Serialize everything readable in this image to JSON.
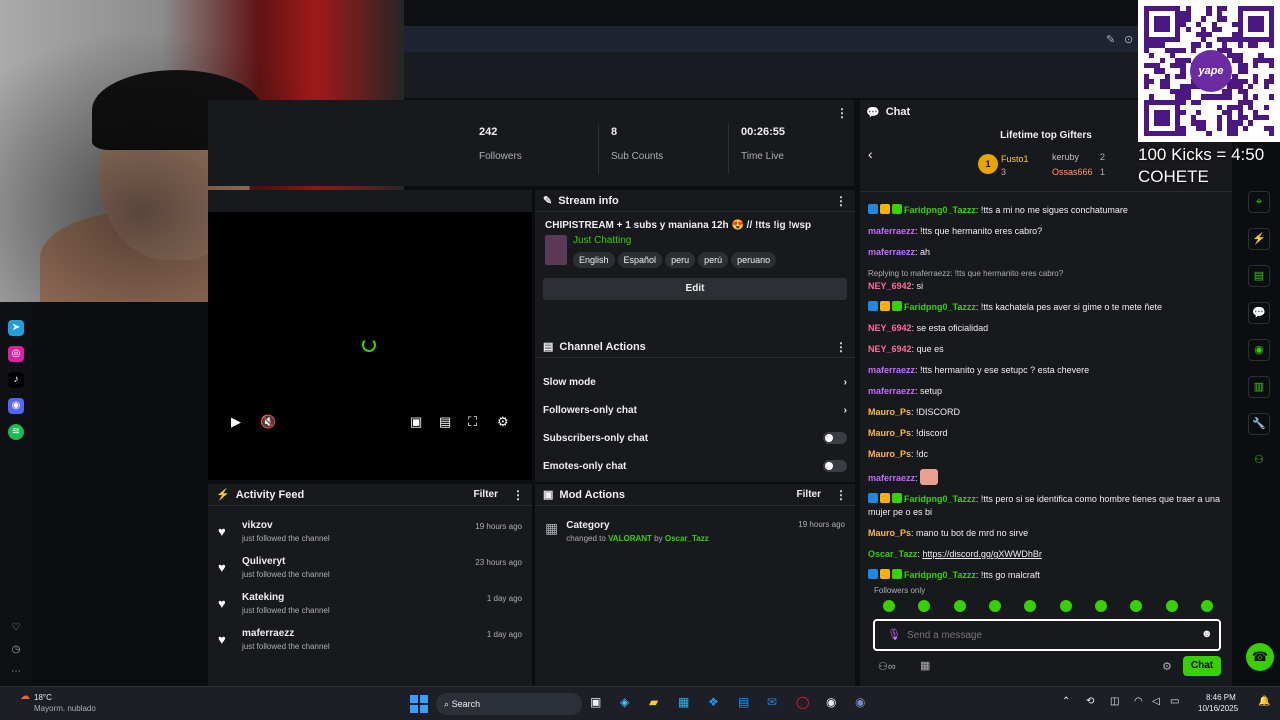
{
  "chat": {
    "title": "Chat",
    "lifetime_title": "Lifetime top Gifters",
    "gifters": [
      {
        "rank": "1",
        "name": "Fusto1",
        "count": "3"
      },
      {
        "name": "keruby",
        "count": "2"
      },
      {
        "name": "Ossas666",
        "count": "1"
      }
    ],
    "messages": [
      {
        "user": "Faridpng0_Tazzz",
        "color": "#37d000",
        "text": "!tts a mi no me sigues conchatumare",
        "badges": true
      },
      {
        "user": "maferraezz",
        "color": "#c36bff",
        "text": "!tts que hermanito eres cabro?"
      },
      {
        "user": "maferraezz",
        "color": "#c36bff",
        "text": "ah"
      },
      {
        "reply": "Replying to maferraezz: !tts que hermanito eres cabro?",
        "user": "NEY_6942",
        "color": "#ff6b9a",
        "text": "si"
      },
      {
        "user": "Faridpng0_Tazzz",
        "color": "#37d000",
        "text": "!tts kachatela pes aver si gime o te mete ñete",
        "badges": true
      },
      {
        "user": "NEY_6942",
        "color": "#ff6b9a",
        "text": "se esta oficialidad"
      },
      {
        "user": "NEY_6942",
        "color": "#ff6b9a",
        "text": "que es"
      },
      {
        "user": "maferraezz",
        "color": "#c36bff",
        "text": "!tts hermanito y ese setupc ? esta chevere"
      },
      {
        "user": "maferraezz",
        "color": "#c36bff",
        "text": "setup"
      },
      {
        "user": "Mauro_Ps",
        "color": "#ffb84d",
        "text": "!DISCORD"
      },
      {
        "user": "Mauro_Ps",
        "color": "#ffb84d",
        "text": "!discord"
      },
      {
        "user": "Mauro_Ps",
        "color": "#ffb84d",
        "text": "!dc"
      },
      {
        "user": "maferraezz",
        "color": "#c36bff",
        "text": ""
      },
      {
        "user": "Faridpng0_Tazzz",
        "color": "#37d000",
        "text": "!tts pero si se identifica como hombre tienes que traer a una mujer pe o es bi",
        "badges": true
      },
      {
        "user": "Mauro_Ps",
        "color": "#ffb84d",
        "text": "mano tu bot de mrd no sirve"
      },
      {
        "user": "Oscar_Tazz",
        "color": "#37d000",
        "text": "https://discord.gg/gXWWDhBr",
        "link": true
      },
      {
        "user": "Faridpng0_Tazzz",
        "color": "#37d000",
        "text": "!tts go malcraft",
        "badges": true
      }
    ],
    "followers_only": "Followers only",
    "input_placeholder": "Send a message",
    "send_label": "Chat"
  },
  "stats": [
    {
      "value": "242",
      "label": "Followers"
    },
    {
      "value": "8",
      "label": "Sub Counts"
    },
    {
      "value": "00:26:55",
      "label": "Time Live"
    }
  ],
  "stream_info": {
    "header": "Stream info",
    "title": "CHIPISTREAM + 1 subs y maniana 12h 😍 // !tts !ig !wsp",
    "category": "Just Chatting",
    "tags": [
      "English",
      "Español",
      "peru",
      "perú",
      "peruano"
    ],
    "edit_label": "Edit"
  },
  "channel_actions": {
    "header": "Channel Actions",
    "items": [
      "Slow mode",
      "Followers-only chat",
      "Subscribers-only chat",
      "Emotes-only chat"
    ]
  },
  "activity": {
    "header": "Activity Feed",
    "filter": "Filter",
    "items": [
      {
        "name": "vikzov",
        "sub": "just followed the channel",
        "time": "19 hours ago"
      },
      {
        "name": "Quliveryt",
        "sub": "just followed the channel",
        "time": "23 hours ago"
      },
      {
        "name": "Kateking",
        "sub": "just followed the channel",
        "time": "1 day ago"
      },
      {
        "name": "maferraezz",
        "sub": "just followed the channel",
        "time": "1 day ago"
      }
    ]
  },
  "mod_actions": {
    "header": "Mod Actions",
    "filter": "Filter",
    "title": "Category",
    "changed_to_prefix": "changed to",
    "category": "VALORANT",
    "by_prefix": "by",
    "by": "Oscar_Tazz",
    "time": "19 hours ago"
  },
  "overlay": {
    "line1": "100 Kicks = 4:50",
    "line2": "COHETE",
    "qr_label": "yape"
  },
  "taskbar": {
    "weather_temp": "18°C",
    "weather_text": "Mayorm. nublado",
    "search": "Search",
    "time": "8:46 PM",
    "date": "10/16/2025"
  },
  "colors": {
    "accent": "#37d000",
    "bg": "#18191c"
  }
}
